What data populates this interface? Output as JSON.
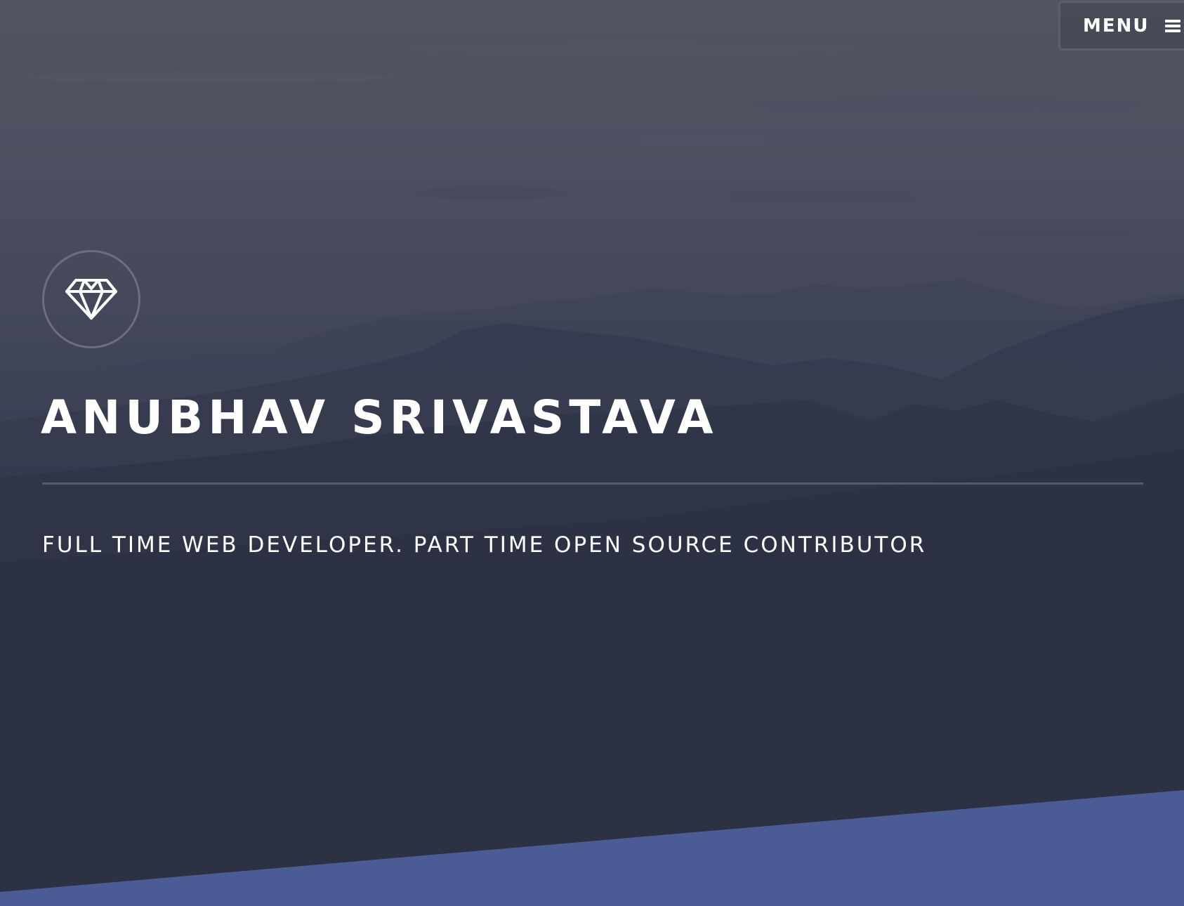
{
  "header": {
    "menu_label": "MENU",
    "menu_icon": "hamburger-icon"
  },
  "hero": {
    "logo_icon": "diamond-icon",
    "title": "ANUBHAV SRIVASTAVA",
    "tagline": "FULL TIME WEB DEVELOPER. PART TIME OPEN SOURCE CONTRIBUTOR"
  },
  "colors": {
    "text": "#ffffff",
    "accent_band": "#4b5b96",
    "background_dark": "#2b3142"
  }
}
